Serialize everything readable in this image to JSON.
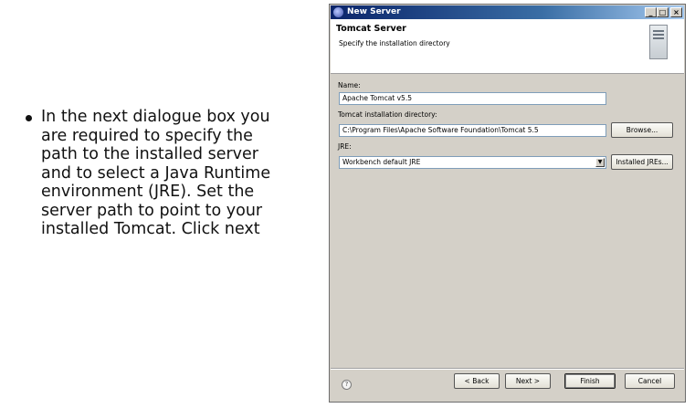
{
  "slide": {
    "bullet_text": "In the next dialogue box you are required to specify the path to the installed server and to select a Java Runtime environment (JRE). Set the server path to point to your installed Tomcat. Click next"
  },
  "window": {
    "title": "New Server",
    "buttons": {
      "minimize": "_",
      "maximize": "□",
      "close": "×"
    }
  },
  "banner": {
    "title": "Tomcat Server",
    "subtitle": "Specify the installation directory"
  },
  "form": {
    "name_label": "Name:",
    "name_value": "Apache Tomcat v5.5",
    "dir_label": "Tomcat installation directory:",
    "dir_value": "C:\\Program Files\\Apache Software Foundation\\Tomcat 5.5",
    "browse_label": "Browse...",
    "jre_label": "JRE:",
    "jre_value": "Workbench default JRE",
    "installed_jres_label": "Installed JREs..."
  },
  "footer": {
    "help_glyph": "?",
    "back_label": "< Back",
    "next_label": "Next >",
    "finish_label": "Finish",
    "cancel_label": "Cancel"
  }
}
